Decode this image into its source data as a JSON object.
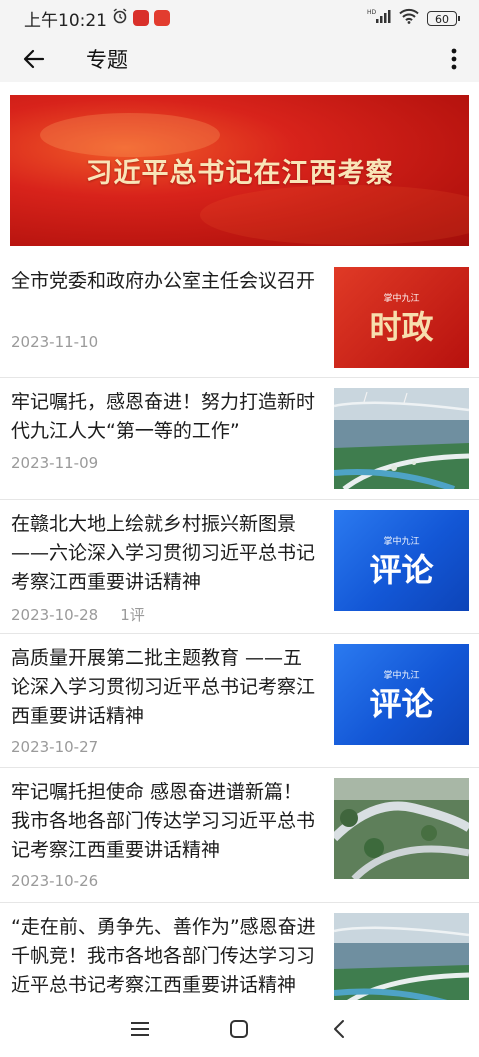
{
  "status_bar": {
    "time": "上午10:21",
    "network_label": "HD",
    "battery_level": "60"
  },
  "app_bar": {
    "title": "专题"
  },
  "banner": {
    "title": "习近平总书记在江西考察"
  },
  "articles": [
    {
      "title": "全市党委和政府办公室主任会议召开",
      "date": "2023-11-10",
      "comments": "",
      "thumb_type": "red",
      "thumb_brand": "掌中九江",
      "thumb_text": "时政"
    },
    {
      "title": "牢记嘱托，感恩奋进！努力打造新时代九江人大“第一等的工作”",
      "date": "2023-11-09",
      "comments": "",
      "thumb_type": "photo-bridge"
    },
    {
      "title": "在赣北大地上绘就乡村振兴新图景——六论深入学习贯彻习近平总书记考察江西重要讲话精神",
      "date": "2023-10-28",
      "comments": "1评",
      "thumb_type": "blue",
      "thumb_brand": "掌中九江",
      "thumb_text": "评论"
    },
    {
      "title": "高质量开展第二批主题教育 ——五论深入学习贯彻习近平总书记考察江西重要讲话精神",
      "date": "2023-10-27",
      "comments": "",
      "thumb_type": "blue",
      "thumb_brand": "掌中九江",
      "thumb_text": "评论"
    },
    {
      "title": "牢记嘱托担使命 感恩奋进谱新篇！我市各地各部门传达学习习近平总书记考察江西重要讲话精神",
      "date": "2023-10-26",
      "comments": "",
      "thumb_type": "photo-overpass"
    },
    {
      "title": "“走在前、勇争先、善作为”感恩奋进千帆竞！我市各地各部门传达学习习近平总书记考察江西重要讲话精神",
      "date": "",
      "comments": "",
      "thumb_type": "photo-bridge"
    }
  ],
  "colors": {
    "banner_red": "#c8180f",
    "banner_text": "#f9e5b8",
    "review_blue": "#1a5fe0",
    "meta_gray": "#9a9a9a"
  }
}
